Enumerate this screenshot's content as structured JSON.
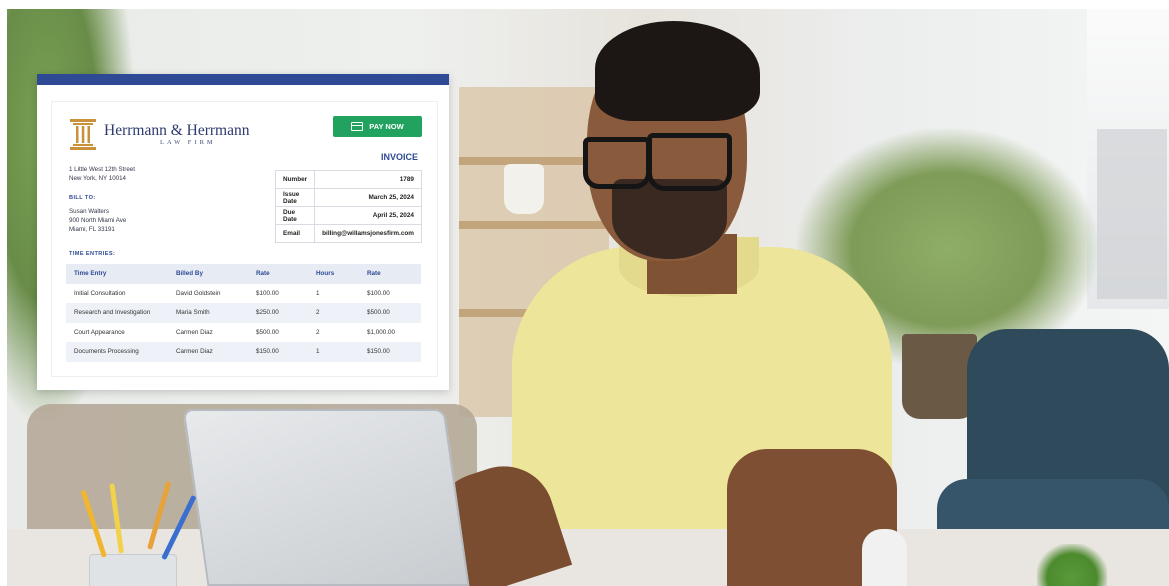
{
  "invoice": {
    "firm_name": "Herrmann & Herrmann",
    "firm_subtitle": "LAW FIRM",
    "pay_button_label": "PAY NOW",
    "title": "INVOICE",
    "firm_address": [
      "1 Little West 12th Street",
      "New York, NY 10014"
    ],
    "bill_to_label": "BILL TO:",
    "bill_to": [
      "Susan Walters",
      "900 North Miami Ave",
      "Miami, FL 33191"
    ],
    "meta": [
      {
        "label": "Number",
        "value": "1789"
      },
      {
        "label": "Issue Date",
        "value": "March 25, 2024"
      },
      {
        "label": "Due Date",
        "value": "April 25, 2024"
      },
      {
        "label": "Email",
        "value": "billing@willamsjonesfirm.com"
      }
    ],
    "time_entries_label": "TIME ENTRIES:",
    "columns": [
      "Time Entry",
      "Billed By",
      "Rate",
      "Hours",
      "Rate"
    ],
    "rows": [
      [
        "Initial Consultation",
        "David Goldstein",
        "$100.00",
        "1",
        "$100.00"
      ],
      [
        "Research and Investigation",
        "Maria Smith",
        "$250.00",
        "2",
        "$500.00"
      ],
      [
        "Court Appearance",
        "Carmen Diaz",
        "$500.00",
        "2",
        "$1,000.00"
      ],
      [
        "Documents Processing",
        "Carmen Diaz",
        "$150.00",
        "1",
        "$150.00"
      ]
    ]
  },
  "colors": {
    "brand_blue": "#2f4a94",
    "pay_green": "#21a35f",
    "logo_gold": "#c9923a",
    "table_header_bg": "#e7ebf4"
  },
  "icons": {
    "logo": "column-pillar-icon",
    "pay": "credit-card-icon"
  }
}
